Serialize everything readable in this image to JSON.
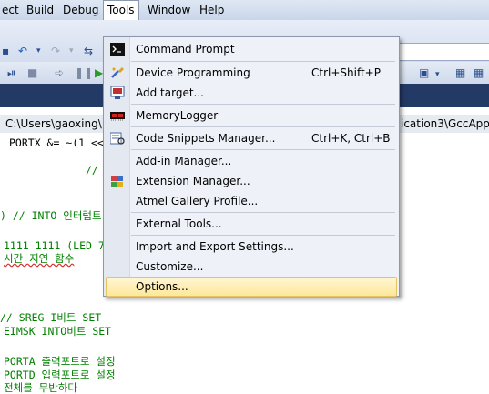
{
  "menubar": {
    "items": [
      "ect",
      "Build",
      "Debug",
      "Tools",
      "Window",
      "Help"
    ]
  },
  "pathbar": {
    "left_text": "C:\\Users\\gaoxing\\",
    "right_text": "ication3\\GccApplic"
  },
  "code": {
    "lines": [
      "PORTX &= ~(1 <<",
      "//",
      ") // INTO 인터럽트",
      "1111 1111 (LED 7",
      "시간 지연 함수",
      "// SREG I비트 SET",
      "EIMSK INTO비트 SET",
      "PORTA 출력포트로 설정",
      "PORTD 입력포트로 설정",
      "전체를 무반하다"
    ]
  },
  "tools_menu": {
    "items": [
      {
        "label": "Command Prompt",
        "shortcut": "",
        "icon": "command-prompt-icon"
      },
      {
        "label": "Device Programming",
        "shortcut": "Ctrl+Shift+P",
        "icon": "device-programming-icon"
      },
      {
        "label": "Add target...",
        "shortcut": "",
        "icon": "add-target-icon"
      },
      {
        "label": "MemoryLogger",
        "shortcut": "",
        "icon": "memory-logger-icon"
      },
      {
        "label": "Code Snippets Manager...",
        "shortcut": "Ctrl+K, Ctrl+B",
        "icon": "code-snippets-icon"
      },
      {
        "label": "Add-in Manager...",
        "shortcut": "",
        "icon": ""
      },
      {
        "label": "Extension Manager...",
        "shortcut": "",
        "icon": "extension-manager-icon"
      },
      {
        "label": "Atmel Gallery Profile...",
        "shortcut": "",
        "icon": ""
      },
      {
        "label": "External Tools...",
        "shortcut": "",
        "icon": ""
      },
      {
        "label": "Import and Export Settings...",
        "shortcut": "",
        "icon": ""
      },
      {
        "label": "Customize...",
        "shortcut": "",
        "icon": ""
      },
      {
        "label": "Options...",
        "shortcut": "",
        "icon": "",
        "highlighted": true
      }
    ]
  }
}
